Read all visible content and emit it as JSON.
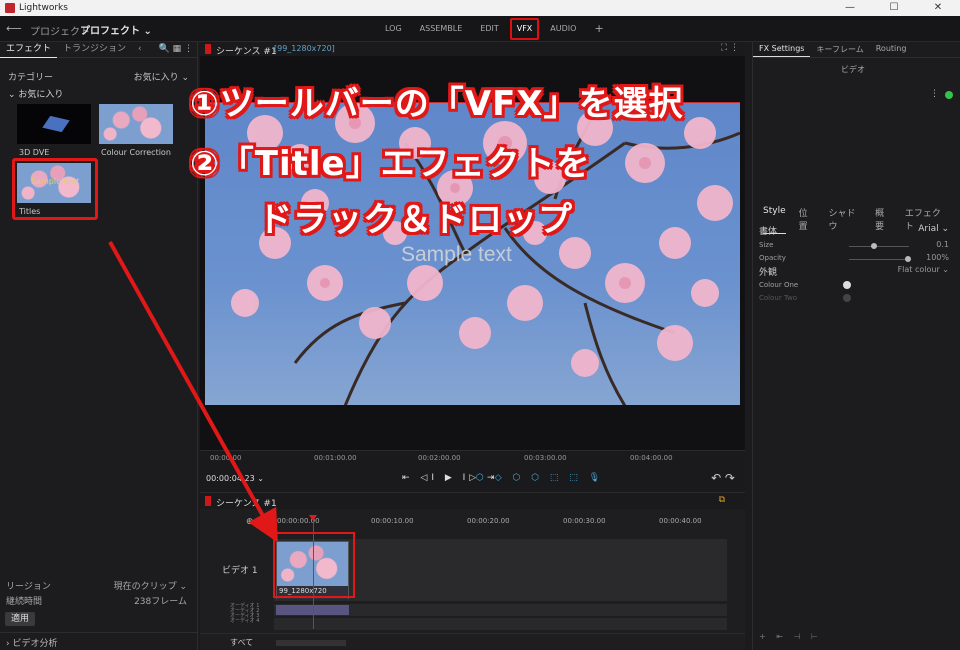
{
  "window": {
    "title": "Lightworks",
    "minimize": "—",
    "maximize": "☐",
    "close": "✕"
  },
  "appbar": {
    "back": "⟵",
    "project_label": "プロジェクト",
    "project_name": "プロフェクト ⌄",
    "tabs": [
      "LOG",
      "ASSEMBLE",
      "EDIT",
      "VFX",
      "AUDIO",
      "+"
    ],
    "active_tab": "VFX"
  },
  "left": {
    "tabs": [
      "エフェクト",
      "トランジション"
    ],
    "tab_more": "‹",
    "icons": "🔍 ▦ ⋮",
    "category": "カテゴリー",
    "favorites_menu": "お気に入り ⌄",
    "favorites_head": "⌄ お気に入り",
    "effects": [
      {
        "label": "3D DVE"
      },
      {
        "label": "Colour Correction"
      },
      {
        "label": "Titles",
        "thumb_text": "Sample text"
      }
    ],
    "region_label": "リージョン",
    "region_value": "現在のクリップ ⌄",
    "duration_label": "継続時間",
    "duration_value": "238フレーム",
    "apply": "適用",
    "analysis": "› ビデオ分析"
  },
  "viewer": {
    "sequence": "シーケンス #1",
    "resolution": "[99_1280x720]",
    "controls": "⛶ ⋮",
    "sample_text": "Sample text",
    "ruler": [
      "00:00:00",
      "00:01:00.00",
      "00:02:00.00",
      "00:03:00.00",
      "00:04:00.00"
    ],
    "timecode": "00:00:04.23 ⌄",
    "transport": "⇤ ◁I ▶ I▷ ⇥",
    "transport2": "⬡ ◇ ⬡ ⬡ ⬚ ⬚ 🎙",
    "undo_redo": "↶ ↷"
  },
  "instructions": {
    "line1": "①ツールバーの「VFX」を選択",
    "line2": "②「Title」エフェクトを",
    "line3": "ドラック＆ドロップ"
  },
  "timeline": {
    "sequence": "シーケンス #1",
    "copy_icon": "⧉",
    "zoom": "⊕ ⊖",
    "ruler": [
      "00:00:00.00",
      "00:00:10.00",
      "00:00:20.00",
      "00:00:30.00",
      "00:00:40.00"
    ],
    "video_label": "ビデオ 1",
    "clip_label": "99_1280x720",
    "audio_labels": [
      "オーディオ 1",
      "オーディオ 2",
      "オーディオ 3",
      "オーディオ 4"
    ],
    "all_label": "すべて"
  },
  "right": {
    "tabs": [
      "FX Settings",
      "キーフレーム",
      "Routing"
    ],
    "video_head": "ビデオ",
    "style_tabs": [
      "Style",
      "位置",
      "シャドウ",
      "概要",
      "エフェクト"
    ],
    "font_label": "書体",
    "font_value": "Arial ⌄",
    "size_label": "Size",
    "size_value": "0.1",
    "opacity_label": "Opacity",
    "opacity_value": "100%",
    "look_label": "外観",
    "look_value": "Flat colour ⌄",
    "colour_one": "Colour One",
    "colour_two": "Colour Two",
    "bottom": "+ ⇤ ⊣ ⊢"
  },
  "colors": {
    "accent": "#e01818",
    "status_green": "#35c24a",
    "link_blue": "#5fa3c8"
  }
}
